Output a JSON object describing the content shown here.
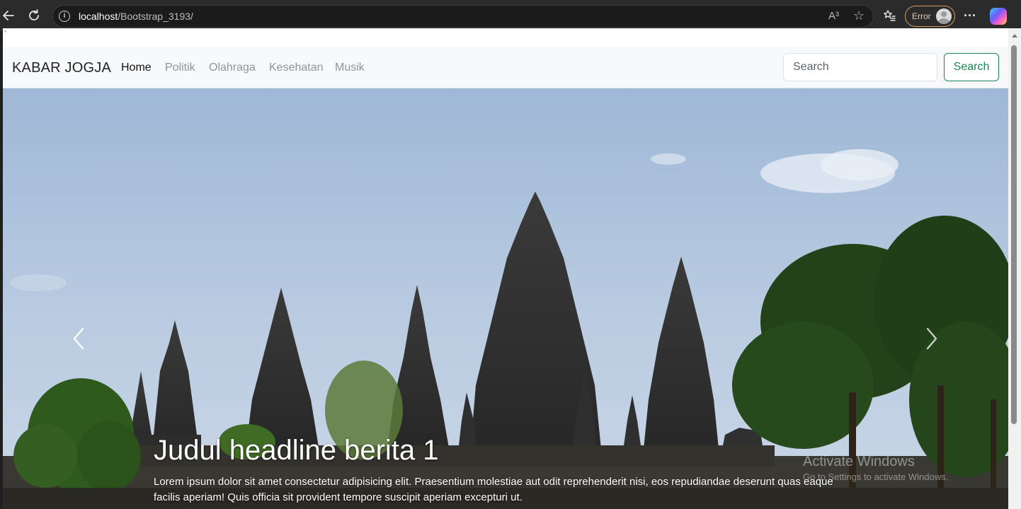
{
  "browser": {
    "url_host": "localhost",
    "url_path": "/Bootstrap_3193/",
    "read_aloud_label": "A³",
    "profile_status": "Error",
    "more_label": "···"
  },
  "page": {
    "stray_text": "\""
  },
  "navbar": {
    "brand": "KABAR JOGJA",
    "links": [
      {
        "label": "Home",
        "active": true
      },
      {
        "label": "Politik",
        "active": false
      },
      {
        "label": "Olahraga",
        "active": false
      },
      {
        "label": "Kesehatan",
        "active": false
      },
      {
        "label": "Musik",
        "active": false
      }
    ],
    "search_placeholder": "Search",
    "search_button": "Search"
  },
  "carousel": {
    "image_alt": "Candi Prambanan",
    "caption_title": "Judul headline berita 1",
    "caption_text": "Lorem ipsum dolor sit amet consectetur adipisicing elit. Praesentium molestiae aut odit reprehenderit nisi, eos repudiandae deserunt quas eaque facilis aperiam! Quis officia sit provident tempore suscipit aperiam excepturi ut."
  },
  "os_overlay": {
    "line1": "Activate Windows",
    "line2": "Go to Settings to activate Windows."
  },
  "colors": {
    "success": "#198754",
    "navbar_bg": "#f8f9fa",
    "chrome_bg": "#2b2b2b"
  }
}
